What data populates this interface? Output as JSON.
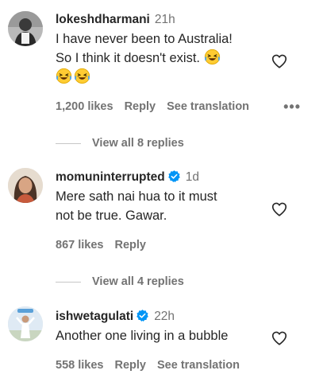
{
  "comments": [
    {
      "username": "lokeshdharmani",
      "verified": false,
      "time": "21h",
      "text_line1": "I have never been to Australia!",
      "text_line2": "So I think it doesn't exist.",
      "likes": "1,200 likes",
      "reply_label": "Reply",
      "translation_label": "See translation",
      "more_label": "•••",
      "view_replies": "View all 8 replies",
      "emoji": "grinning-squinting-tears-emoji"
    },
    {
      "username": "momuninterrupted",
      "verified": true,
      "time": "1d",
      "text_line1": "Mere sath nai hua to it must",
      "text_line2": "not be true. Gawar.",
      "likes": "867 likes",
      "reply_label": "Reply",
      "view_replies": "View all 4 replies"
    },
    {
      "username": "ishwetagulati",
      "verified": true,
      "time": "22h",
      "text_line1": "Another one living in a bubble",
      "likes": "558 likes",
      "reply_label": "Reply",
      "translation_label": "See translation"
    }
  ],
  "colors": {
    "text": "#262626",
    "secondary": "#737373",
    "verified": "#0095f6",
    "emoji_face": "#ffcc33"
  },
  "icons": {
    "like": "heart-outline-icon",
    "verified": "verified-badge-icon",
    "more": "more-options-icon"
  }
}
